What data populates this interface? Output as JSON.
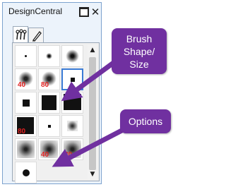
{
  "window": {
    "title": "DesignCentral",
    "minimize_label": "",
    "close_label": "✕"
  },
  "tabs": [
    {
      "name": "brushes-tab",
      "icon": "brush-set-icon",
      "active": true
    },
    {
      "name": "pen-tab",
      "icon": "pen-icon",
      "active": false
    }
  ],
  "brushes": [
    {
      "shape": "dot-small",
      "size_label": ""
    },
    {
      "shape": "soft-small",
      "size_label": ""
    },
    {
      "shape": "soft-medium",
      "size_label": ""
    },
    {
      "shape": "soft-large",
      "size_label": "40"
    },
    {
      "shape": "soft-large",
      "size_label": "80"
    },
    {
      "shape": "square-small",
      "size_label": "",
      "selected": true
    },
    {
      "shape": "square-medium",
      "size_label": ""
    },
    {
      "shape": "square-large",
      "size_label": ""
    },
    {
      "shape": "square-xlarge",
      "size_label": ""
    },
    {
      "shape": "square-large",
      "size_label": "80"
    },
    {
      "shape": "square-tiny",
      "size_label": ""
    },
    {
      "shape": "square-soft",
      "size_label": ""
    },
    {
      "shape": "fuzzy-square",
      "size_label": ""
    },
    {
      "shape": "fuzzy-square",
      "size_label": "40"
    },
    {
      "shape": "fuzzy-square",
      "size_label": "80"
    },
    {
      "shape": "circle",
      "size_label": ""
    }
  ],
  "callouts": {
    "brush": "Brush Shape/ Size",
    "options": "Options"
  },
  "colors": {
    "accent": "#7030a0",
    "size_label": "#e02020",
    "selection": "#3a7bd5"
  }
}
